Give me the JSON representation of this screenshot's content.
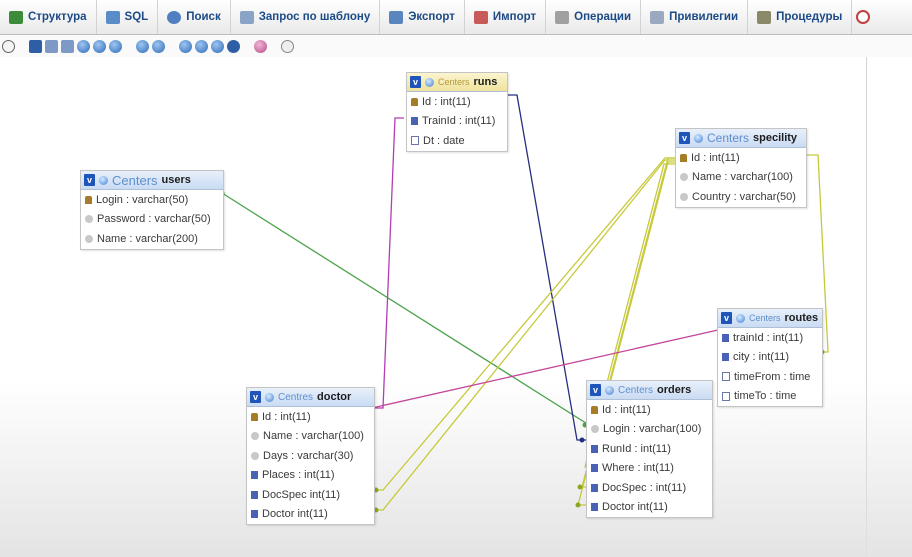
{
  "tabs": [
    {
      "label": "Структура",
      "icon": "structure-icon",
      "color": "#3d8c3a"
    },
    {
      "label": "SQL",
      "icon": "sql-icon",
      "color": "#5a8cc8"
    },
    {
      "label": "Поиск",
      "icon": "search-icon",
      "color": "#4f7fc0"
    },
    {
      "label": "Запрос по шаблону",
      "icon": "query-icon",
      "color": "#8aa4c8"
    },
    {
      "label": "Экспорт",
      "icon": "export-icon",
      "color": "#5a86c0"
    },
    {
      "label": "Импорт",
      "icon": "import-icon",
      "color": "#c85a5a"
    },
    {
      "label": "Операции",
      "icon": "wrench-icon",
      "color": "#a0a0a0"
    },
    {
      "label": "Привилегии",
      "icon": "privileges-icon",
      "color": "#9aa8c0"
    },
    {
      "label": "Процедуры",
      "icon": "procedures-icon",
      "color": "#8a8a6a"
    }
  ],
  "tables": {
    "users": {
      "schema": "Centers",
      "name": "users",
      "fields": [
        {
          "text": "Login : varchar(50)",
          "type": "key"
        },
        {
          "text": "Password : varchar(50)",
          "type": "chr"
        },
        {
          "text": "Name : varchar(200)",
          "type": "chr"
        }
      ]
    },
    "runs": {
      "schema": "Centers",
      "name": "runs",
      "fields": [
        {
          "text": "Id : int(11)",
          "type": "key"
        },
        {
          "text": "TrainId : int(11)",
          "type": "int"
        },
        {
          "text": "Dt : date",
          "type": "dt"
        }
      ]
    },
    "specility": {
      "schema": "Centers",
      "name": "specility",
      "fields": [
        {
          "text": "Id : int(11)",
          "type": "key"
        },
        {
          "text": "Name : varchar(100)",
          "type": "chr"
        },
        {
          "text": "Country : varchar(50)",
          "type": "chr"
        }
      ]
    },
    "routes": {
      "schema": "Centers",
      "name": "routes",
      "fields": [
        {
          "text": "trainId : int(11)",
          "type": "int"
        },
        {
          "text": "city : int(11)",
          "type": "int"
        },
        {
          "text": "timeFrom : time",
          "type": "dt"
        },
        {
          "text": "timeTo : time",
          "type": "dt"
        }
      ]
    },
    "doctor": {
      "schema": "Centres",
      "name": "doctor",
      "fields": [
        {
          "text": "Id : int(11)",
          "type": "key"
        },
        {
          "text": "Name : varchar(100)",
          "type": "chr"
        },
        {
          "text": "Days : varchar(30)",
          "type": "chr"
        },
        {
          "text": "Places : int(11)",
          "type": "int"
        },
        {
          "text": "DocSpec  int(11)",
          "type": "int"
        },
        {
          "text": "Doctor int(11)",
          "type": "int"
        }
      ]
    },
    "orders": {
      "schema": "Centers",
      "name": "orders",
      "fields": [
        {
          "text": "Id : int(11)",
          "type": "key"
        },
        {
          "text": "Login : varchar(100)",
          "type": "chr"
        },
        {
          "text": "RunId : int(11)",
          "type": "int"
        },
        {
          "text": "Where : int(11)",
          "type": "int"
        },
        {
          "text": "DocSpec   : int(11)",
          "type": "int"
        },
        {
          "text": "Doctor int(11)",
          "type": "int"
        }
      ]
    }
  },
  "relation_colors": {
    "users_orders": "#4aa24a",
    "runs_doctor": "#b23db5",
    "runs_orders": "#24307f",
    "specility_links": "#c7c93a",
    "routes_doctor": "#c4469b"
  }
}
